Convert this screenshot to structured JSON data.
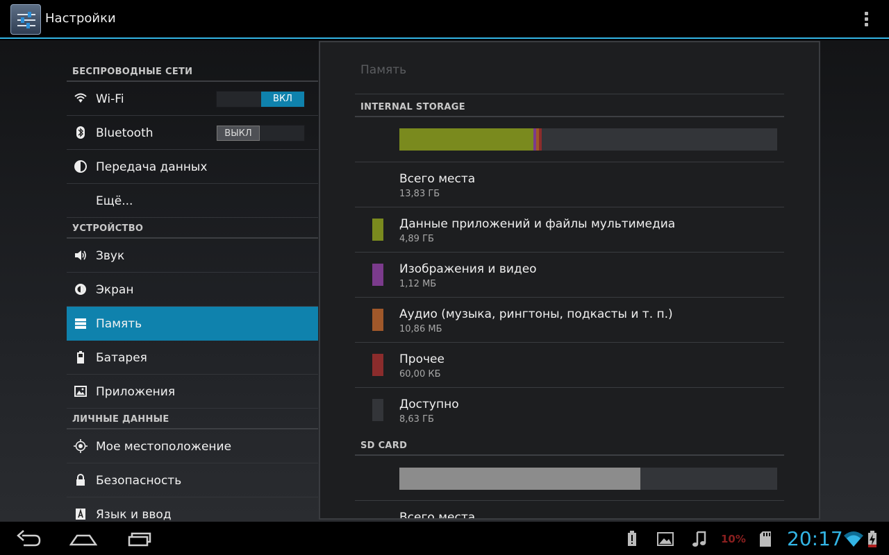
{
  "app": {
    "title": "Настройки"
  },
  "left": {
    "sections": [
      {
        "header": "БЕСПРОВОДНЫЕ СЕТИ",
        "items": [
          {
            "label": "Wi-Fi",
            "icon": "wifi-icon",
            "switch": "ВКЛ",
            "state": "on"
          },
          {
            "label": "Bluetooth",
            "icon": "bluetooth-icon",
            "switch": "ВЫКЛ",
            "state": "off"
          },
          {
            "label": "Передача данных",
            "icon": "data-usage-icon"
          },
          {
            "label": "Ещё..."
          }
        ]
      },
      {
        "header": "УСТРОЙСТВО",
        "items": [
          {
            "label": "Звук",
            "icon": "sound-icon"
          },
          {
            "label": "Экран",
            "icon": "display-icon"
          },
          {
            "label": "Память",
            "icon": "storage-icon",
            "selected": true
          },
          {
            "label": "Батарея",
            "icon": "battery-icon"
          },
          {
            "label": "Приложения",
            "icon": "apps-icon"
          }
        ]
      },
      {
        "header": "ЛИЧНЫЕ ДАННЫЕ",
        "items": [
          {
            "label": "Мое местоположение",
            "icon": "location-icon"
          },
          {
            "label": "Безопасность",
            "icon": "lock-icon"
          },
          {
            "label": "Язык и ввод",
            "icon": "language-icon"
          }
        ]
      }
    ]
  },
  "right": {
    "title": "Память",
    "internal": {
      "header": "INTERNAL STORAGE",
      "usage_fractions": {
        "apps": 0.354,
        "images": 0.001,
        "audio": 0.001,
        "other": 0.0
      },
      "total_label": "Всего места",
      "total_value": "13,83 ГБ",
      "categories": [
        {
          "name": "Данные приложений и файлы мультимедиа",
          "value": "4,89 ГБ",
          "color": "#7a8a1e"
        },
        {
          "name": "Изображения и видео",
          "value": "1,12 МБ",
          "color": "#7b3b8c"
        },
        {
          "name": "Аудио (музыка, рингтоны, подкасты и т. п.)",
          "value": "10,86 МБ",
          "color": "#a0582a"
        },
        {
          "name": "Прочее",
          "value": "60,00 КБ",
          "color": "#8b2c2c"
        },
        {
          "name": "Доступно",
          "value": "8,63 ГБ",
          "color": "#333539"
        }
      ]
    },
    "sd": {
      "header": "SD CARD",
      "usage_fraction": 0.637,
      "total_label": "Всего места"
    }
  },
  "statusbar": {
    "time": "20:17",
    "battery_percent": "10%"
  }
}
